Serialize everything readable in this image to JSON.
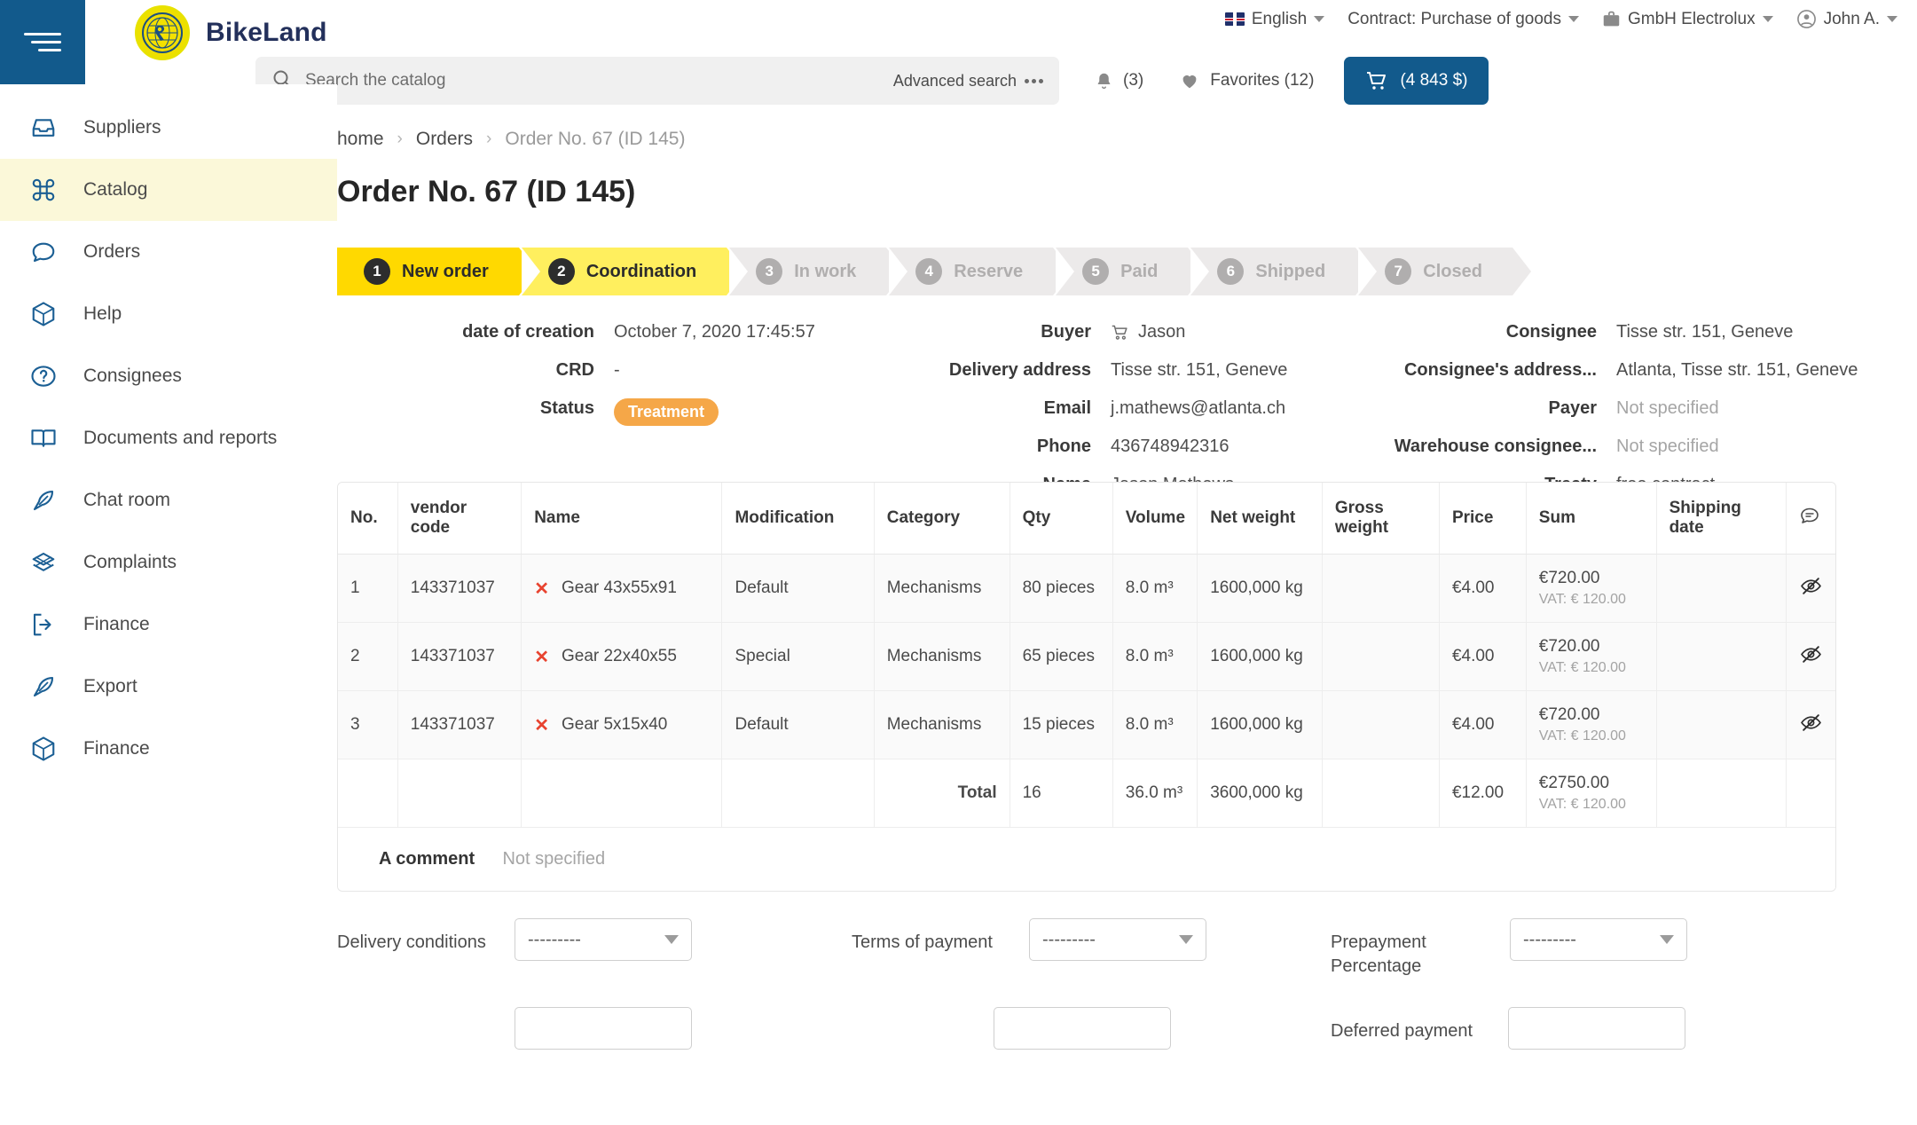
{
  "brand": {
    "name": "BikeLand"
  },
  "topnav": {
    "language": "English",
    "contract": "Contract: Purchase of goods",
    "company": "GmbH Electrolux",
    "user": "John A."
  },
  "search": {
    "placeholder": "Search the catalog",
    "value": "",
    "advanced_label": "Advanced search",
    "notifications": "(3)",
    "favorites": "Favorites (12)",
    "cart": "(4 843 $)"
  },
  "sidebar": {
    "items": [
      {
        "label": "Suppliers",
        "icon": "inbox-icon",
        "active": false
      },
      {
        "label": "Catalog",
        "icon": "command-icon",
        "active": true
      },
      {
        "label": "Orders",
        "icon": "chat-bubble-icon",
        "active": false
      },
      {
        "label": "Help",
        "icon": "box-icon",
        "active": false
      },
      {
        "label": "Consignees",
        "icon": "question-circle-icon",
        "active": false
      },
      {
        "label": "Documents and reports",
        "icon": "book-icon",
        "active": false
      },
      {
        "label": "Chat room",
        "icon": "feather-icon",
        "active": false
      },
      {
        "label": "Complaints",
        "icon": "layers-icon",
        "active": false
      },
      {
        "label": "Finance",
        "icon": "logout-icon",
        "active": false
      },
      {
        "label": "Export",
        "icon": "feather-icon",
        "active": false
      },
      {
        "label": "Finance",
        "icon": "box-icon",
        "active": false
      }
    ]
  },
  "breadcrumb": {
    "home": "home",
    "orders": "Orders",
    "current": "Order No. 67 (ID 145)"
  },
  "page": {
    "title": "Order No. 67 (ID 145)"
  },
  "stepper": {
    "steps": [
      {
        "num": "1",
        "label": "New order"
      },
      {
        "num": "2",
        "label": "Coordination"
      },
      {
        "num": "3",
        "label": "In work"
      },
      {
        "num": "4",
        "label": "Reserve"
      },
      {
        "num": "5",
        "label": "Paid"
      },
      {
        "num": "6",
        "label": "Shipped"
      },
      {
        "num": "7",
        "label": "Closed"
      }
    ]
  },
  "details": {
    "col_a": [
      {
        "label": "date of creation",
        "value": "October 7, 2020 17:45:57",
        "muted": false
      },
      {
        "label": "CRD",
        "value": "-",
        "muted": false
      },
      {
        "label": "Status",
        "value": "Treatment",
        "badge": true
      }
    ],
    "col_b": [
      {
        "label": "Buyer",
        "value": "Jason",
        "icon": "cart-icon"
      },
      {
        "label": "Delivery address",
        "value": "Tisse str. 151, Geneve"
      },
      {
        "label": "Email",
        "value": "j.mathews@atlanta.ch"
      },
      {
        "label": "Phone",
        "value": "436748942316"
      },
      {
        "label": "Name",
        "value": "Jason Mathews"
      }
    ],
    "col_c": [
      {
        "label": "Consignee",
        "value": "Tisse str. 151, Geneve",
        "muted": false
      },
      {
        "label": "Consignee's address...",
        "value": "Atlanta, Tisse str. 151, Geneve",
        "muted": false
      },
      {
        "label": "Payer",
        "value": "Not specified",
        "muted": true
      },
      {
        "label": "Warehouse consignee...",
        "value": "Not specified",
        "muted": true
      },
      {
        "label": "Treaty",
        "value": "free contract",
        "muted": false
      }
    ]
  },
  "table": {
    "headers": [
      "No.",
      "vendor code",
      "Name",
      "Modification",
      "Category",
      "Qty",
      "Volume",
      "Net weight",
      "Gross weight",
      "Price",
      "Sum",
      "Shipping date",
      ""
    ],
    "rows": [
      {
        "no": "1",
        "vendor_code": "143371037",
        "name": "Gear 43x55x91",
        "modification": "Default",
        "category": "Mechanisms",
        "qty": "80 pieces",
        "volume": "8.0 m³",
        "net_weight": "1600,000 kg",
        "gross_weight": "",
        "price": "€4.00",
        "sum": "€720.00",
        "vat": "VAT: € 120.00",
        "shipping_date": ""
      },
      {
        "no": "2",
        "vendor_code": "143371037",
        "name": "Gear 22x40x55",
        "modification": "Special",
        "category": "Mechanisms",
        "qty": "65 pieces",
        "volume": "8.0 m³",
        "net_weight": "1600,000 kg",
        "gross_weight": "",
        "price": "€4.00",
        "sum": "€720.00",
        "vat": "VAT: € 120.00",
        "shipping_date": ""
      },
      {
        "no": "3",
        "vendor_code": "143371037",
        "name": "Gear 5x15x40",
        "modification": "Default",
        "category": "Mechanisms",
        "qty": "15 pieces",
        "volume": "8.0 m³",
        "net_weight": "1600,000 kg",
        "gross_weight": "",
        "price": "€4.00",
        "sum": "€720.00",
        "vat": "VAT: € 120.00",
        "shipping_date": ""
      }
    ],
    "total": {
      "label": "Total",
      "qty": "16",
      "volume": "36.0 m³",
      "net_weight": "3600,000 kg",
      "gross_weight": "",
      "price": "€12.00",
      "sum": "€2750.00",
      "vat": "VAT: € 120.00",
      "shipping_date": ""
    },
    "comment": {
      "label": "A comment",
      "value": "Not specified"
    }
  },
  "form": {
    "delivery_conditions": {
      "label": "Delivery conditions",
      "value": "---------"
    },
    "terms_of_payment": {
      "label": "Terms of payment",
      "value": "---------"
    },
    "prepayment_percentage": {
      "label": "Prepayment Percentage",
      "value": "---------"
    },
    "deferred_payment": {
      "label": "Deferred payment"
    }
  }
}
